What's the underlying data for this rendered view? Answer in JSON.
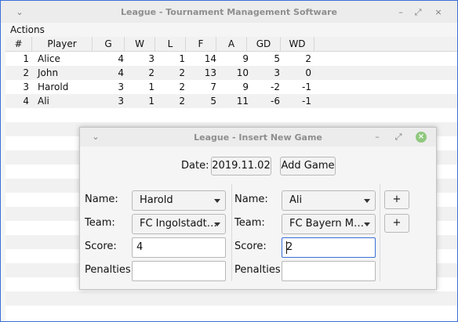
{
  "window": {
    "title": "League - Tournament Management Software"
  },
  "menubar": {
    "actions": "Actions"
  },
  "table": {
    "headers": [
      "#",
      "Player",
      "G",
      "W",
      "L",
      "F",
      "A",
      "GD",
      "WD"
    ],
    "rows": [
      [
        "1",
        "Alice",
        "4",
        "3",
        "1",
        "14",
        "9",
        "5",
        "2"
      ],
      [
        "2",
        "John",
        "4",
        "2",
        "2",
        "13",
        "10",
        "3",
        "0"
      ],
      [
        "3",
        "Harold",
        "3",
        "1",
        "2",
        "7",
        "9",
        "-2",
        "-1"
      ],
      [
        "4",
        "Ali",
        "3",
        "1",
        "2",
        "5",
        "11",
        "-6",
        "-1"
      ]
    ]
  },
  "dialog": {
    "title": "League - Insert New Game",
    "date_label": "Date:",
    "date_value": "2019.11.02",
    "add_game": "Add Game",
    "name_label": "Name:",
    "team_label": "Team:",
    "score_label": "Score:",
    "penalties_label": "Penalties:",
    "left": {
      "name": "Harold",
      "team": "FC Ingolstadt…",
      "score": "4",
      "penalties": ""
    },
    "right": {
      "name": "Ali",
      "team": "FC Bayern M…",
      "score": "2",
      "penalties": ""
    },
    "plus": "+"
  },
  "colors": {
    "border": "#3a6fd8",
    "close": "#8fc87e",
    "alt_row": "#f1f1f1"
  }
}
